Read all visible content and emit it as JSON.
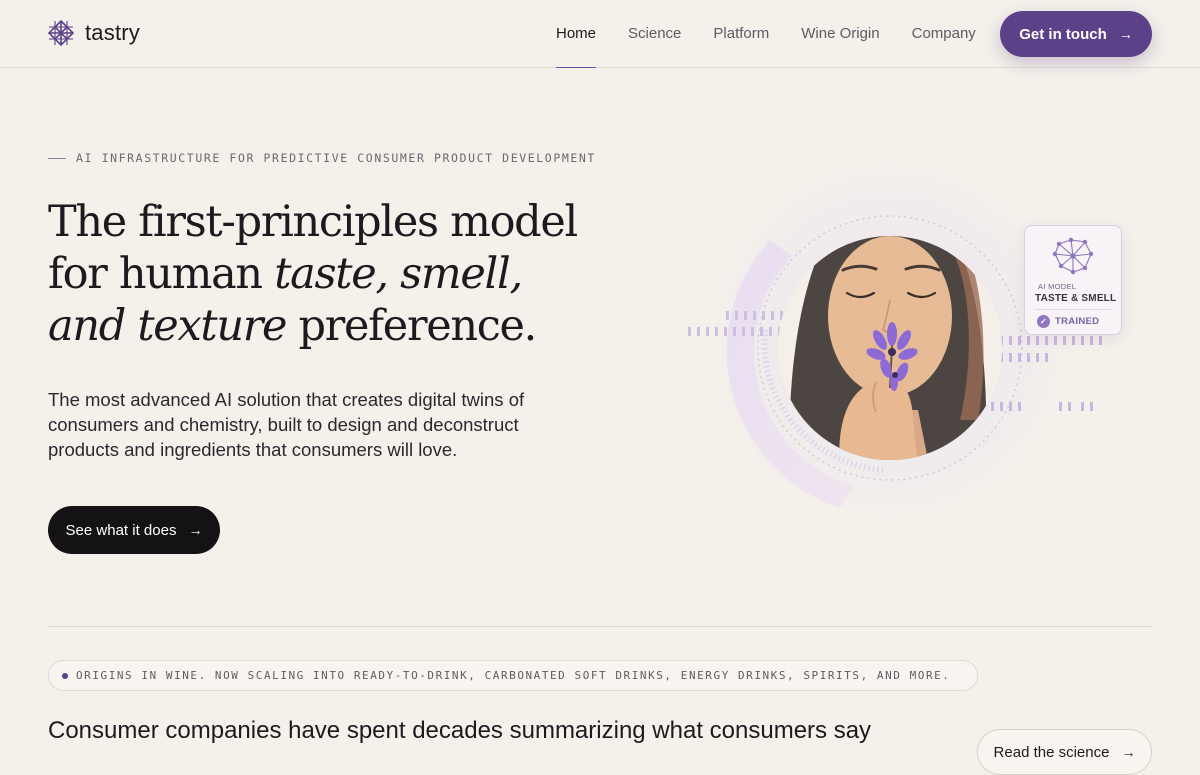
{
  "brand": {
    "name": "tastry"
  },
  "nav": {
    "items": [
      {
        "label": "Home",
        "active": true
      },
      {
        "label": "Science",
        "active": false
      },
      {
        "label": "Platform",
        "active": false
      },
      {
        "label": "Wine Origin",
        "active": false
      },
      {
        "label": "Company",
        "active": false
      }
    ],
    "cta_label": "Get in touch",
    "cta_icon": "arrow-right-icon"
  },
  "hero": {
    "eyebrow": "AI INFRASTRUCTURE FOR PREDICTIVE CONSUMER PRODUCT DEVELOPMENT",
    "headline": {
      "line1": "The first-principles model",
      "line2_plain": "for human ",
      "line2_italic": "taste, smell,",
      "line3_italic": "and texture",
      "line3_plain": " preference."
    },
    "lead": "The most advanced AI solution that creates digital twins of consumers and chemistry, built to design and deconstruct products and ingredients that consumers will love.",
    "button_label": "See what it does",
    "button_icon": "arrow-right-icon"
  },
  "ai_card": {
    "label": "AI MODEL",
    "title": "TASTE & SMELL",
    "status": "TRAINED",
    "icon": "neural-network-icon"
  },
  "origins": {
    "pill_text": "ORIGINS IN WINE. NOW SCALING INTO READY-TO-DRINK, CARBONATED SOFT DRINKS, ENERGY DRINKS, SPIRITS, AND MORE.",
    "subhead": "Consumer companies have spent decades summarizing what consumers say",
    "button_label": "Read the science",
    "button_icon": "arrow-right-icon"
  },
  "colors": {
    "background": "#f4f0ea",
    "accent": "#5b4188",
    "dark_button": "#151216",
    "flower": "#8e6ad6"
  }
}
